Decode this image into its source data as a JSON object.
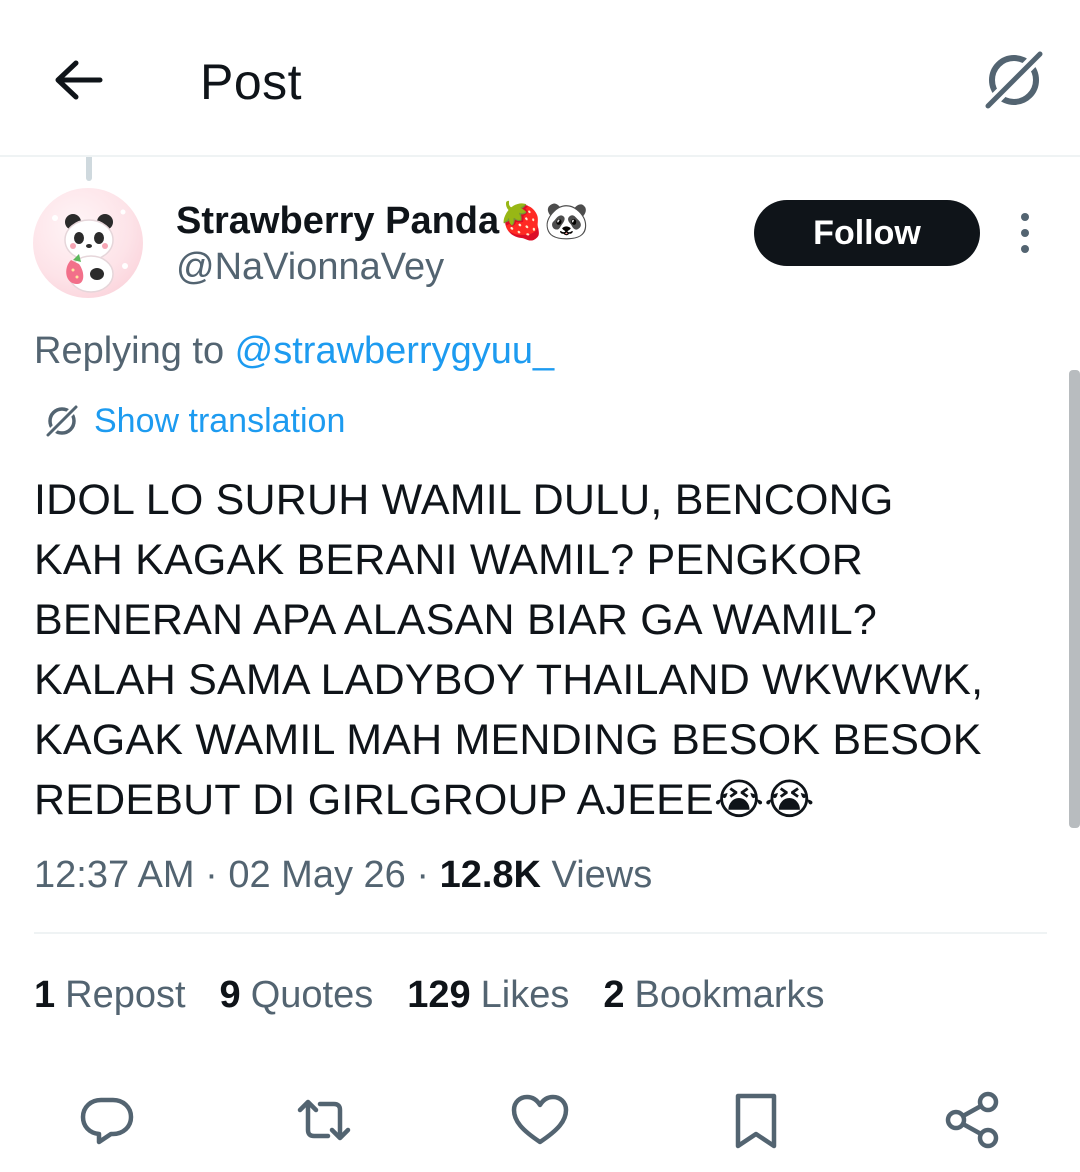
{
  "header": {
    "title": "Post",
    "back_icon": "arrow-left-icon",
    "grok_icon": "grok-icon"
  },
  "author": {
    "display_name": "Strawberry Panda",
    "name_emojis": "🍓🐼",
    "handle": "@NaVionnaVey",
    "avatar_desc": "avatar"
  },
  "follow_label": "Follow",
  "reply_context": {
    "prefix": "Replying to ",
    "target": "@strawberrygyuu_"
  },
  "translation_label": "Show translation",
  "tweet_text": "IDOL LO SURUH WAMIL DULU, BENCONG\nKAH KAGAK BERANI WAMIL? PENGKOR\nBENERAN APA ALASAN BIAR GA WAMIL?\nKALAH SAMA LADYBOY THAILAND WKWKWK,\nKAGAK WAMIL MAH MENDING BESOK BESOK\nREDEBUT DI GIRLGROUP AJEEE😭😭",
  "meta": {
    "time": "12:37 AM",
    "date": "02 May 26",
    "views_count": "12.8K",
    "views_label": "Views",
    "sep": " · "
  },
  "stats": [
    {
      "count": "1",
      "label": "Repost"
    },
    {
      "count": "9",
      "label": "Quotes"
    },
    {
      "count": "129",
      "label": "Likes"
    },
    {
      "count": "2",
      "label": "Bookmarks"
    }
  ],
  "colors": {
    "text": "#0f1419",
    "secondary": "#536471",
    "accent": "#1d9bf0",
    "border": "#eff3f4"
  }
}
